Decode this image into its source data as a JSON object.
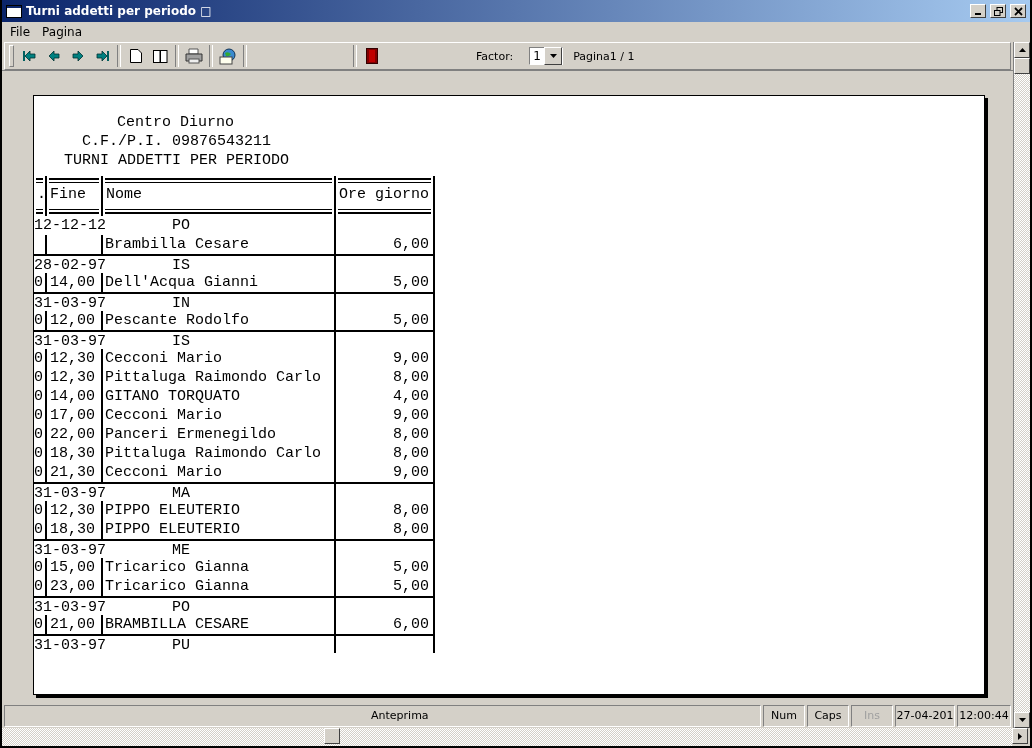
{
  "window": {
    "title": "Turni addetti per periodo □"
  },
  "menu": [
    "File",
    "Pagina"
  ],
  "toolbar": {
    "factor_label": "Factor:",
    "factor_value": "1",
    "page_label": "Pagina1 / 1"
  },
  "report": {
    "header_lines": [
      "Centro Diurno",
      "C.F./P.I. 09876543211",
      "TURNI ADDETTI PER PERIODO"
    ],
    "columns": [
      ".",
      "Fine",
      "Nome",
      "Ore giorno"
    ],
    "groups": [
      {
        "date": "12-12-12",
        "code": "PO",
        "rows": [
          {
            "nome": "Brambilla Cesare",
            "ore": "6,00"
          }
        ]
      },
      {
        "date": "28-02-97",
        "code": "IS",
        "rows": [
          {
            "column_1": "0",
            "fine": "14,00",
            "nome": "Dell'Acqua Gianni",
            "ore": "5,00"
          }
        ]
      },
      {
        "date": "31-03-97",
        "code": "IN",
        "rows": [
          {
            "column_1": "0",
            "fine": "12,00",
            "nome": "Pescante Rodolfo",
            "ore": "5,00"
          }
        ]
      },
      {
        "date": "31-03-97",
        "code": "IS",
        "rows": [
          {
            "column_1": "0",
            "fine": "12,30",
            "nome": "Cecconi Mario",
            "ore": "9,00"
          },
          {
            "column_1": "0",
            "fine": "12,30",
            "nome": "Pittaluga Raimondo Carlo",
            "ore": "8,00"
          },
          {
            "column_1": "0",
            "fine": "14,00",
            "nome": "GITANO TORQUATO",
            "ore": "4,00"
          },
          {
            "column_1": "0",
            "fine": "17,00",
            "nome": "Cecconi Mario",
            "ore": "9,00"
          },
          {
            "column_1": "0",
            "fine": "22,00",
            "nome": "Panceri Ermenegildo",
            "ore": "8,00"
          },
          {
            "column_1": "0",
            "fine": "18,30",
            "nome": "Pittaluga Raimondo Carlo",
            "ore": "8,00"
          },
          {
            "column_1": "0",
            "fine": "21,30",
            "nome": "Cecconi Mario",
            "ore": "9,00"
          }
        ]
      },
      {
        "date": "31-03-97",
        "code": "MA",
        "rows": [
          {
            "column_1": "0",
            "fine": "12,30",
            "nome": "PIPPO ELEUTERIO",
            "ore": "8,00"
          },
          {
            "column_1": "0",
            "fine": "18,30",
            "nome": "PIPPO ELEUTERIO",
            "ore": "8,00"
          }
        ]
      },
      {
        "date": "31-03-97",
        "code": "ME",
        "rows": [
          {
            "column_1": "0",
            "fine": "15,00",
            "nome": "Tricarico Gianna",
            "ore": "5,00"
          },
          {
            "column_1": "0",
            "fine": "23,00",
            "nome": "Tricarico Gianna",
            "ore": "5,00"
          }
        ]
      },
      {
        "date": "31-03-97",
        "code": "PO",
        "rows": [
          {
            "column_1": "0",
            "fine": "21,00",
            "nome": "BRAMBILLA CESARE",
            "ore": "6,00"
          }
        ]
      },
      {
        "date": "31-03-97",
        "code": "PU"
      }
    ]
  },
  "status_bar": {
    "message": "Anteprima",
    "indicators": [
      {
        "label": "Num",
        "disabled": false
      },
      {
        "label": "Caps",
        "disabled": false
      },
      {
        "label": "Ins",
        "disabled": true
      }
    ],
    "date": "27-04-201",
    "time": "12:00:44"
  }
}
